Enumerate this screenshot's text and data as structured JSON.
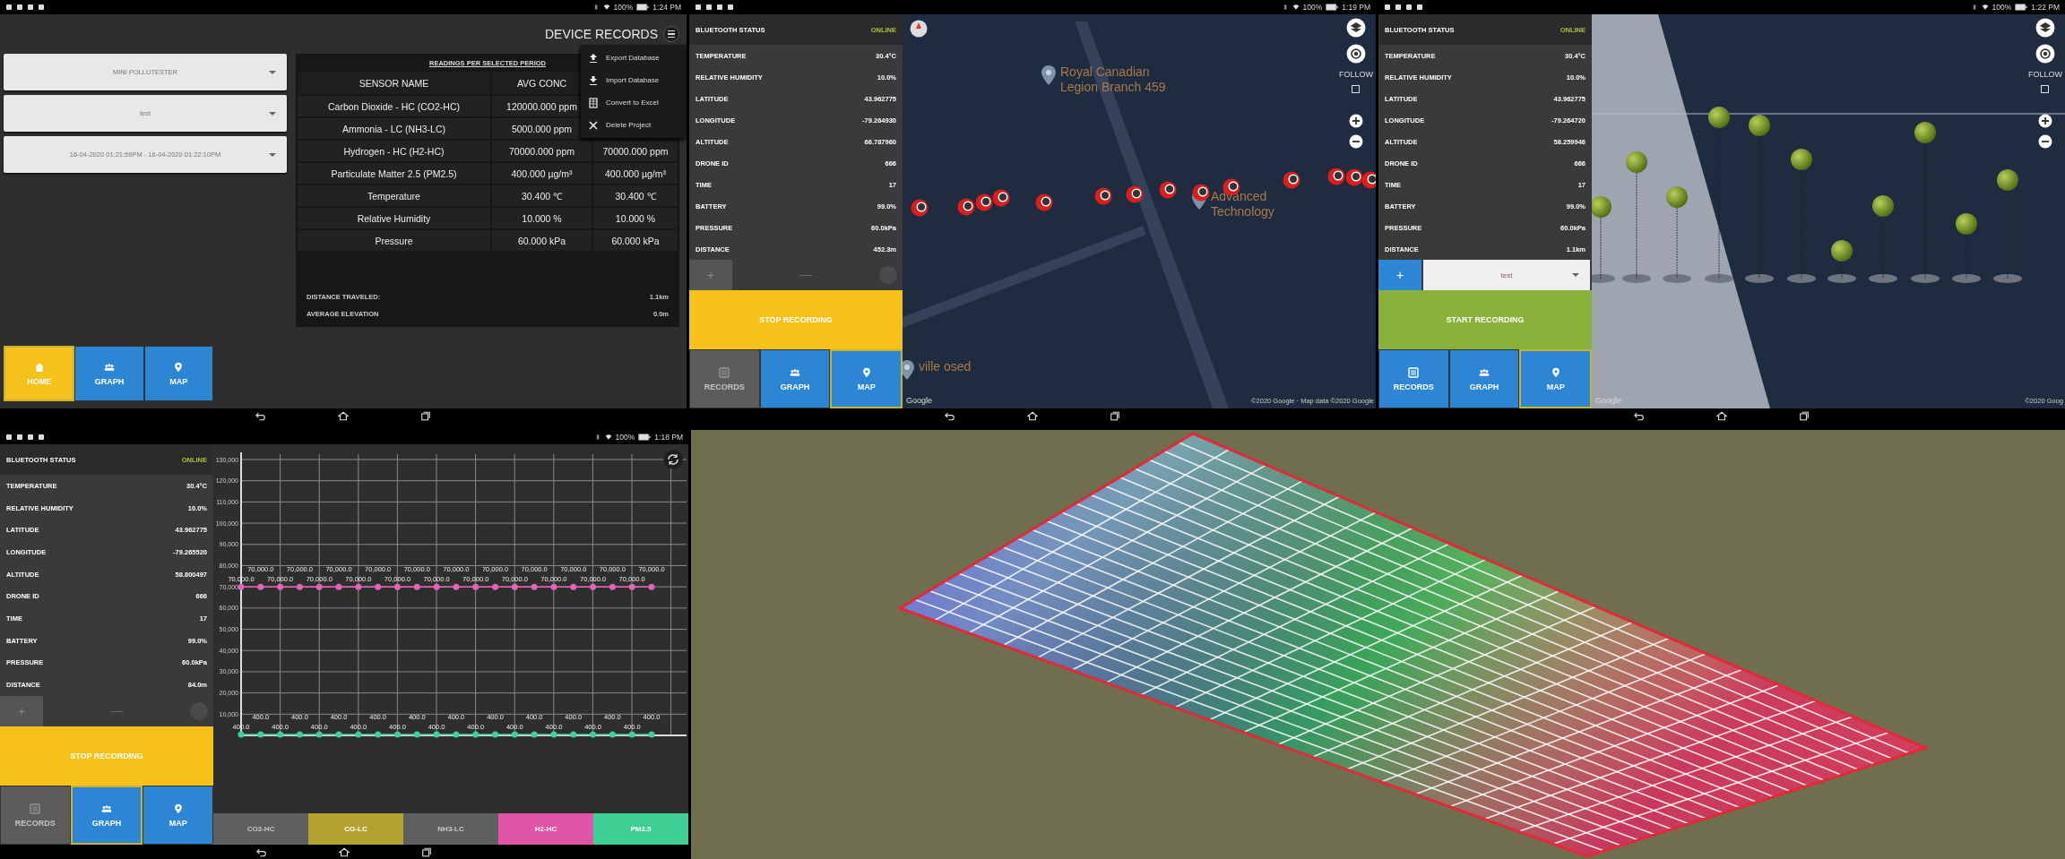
{
  "records_screen": {
    "status_bar": {
      "battery": "100%",
      "time": "1:24 PM"
    },
    "title": "DEVICE RECORDS",
    "dropdowns": [
      {
        "value": "MINI POLLUTESTER"
      },
      {
        "value": "test"
      },
      {
        "value": "16-04-2020 01:21:59PM - 16-04-2020 01:22:10PM"
      }
    ],
    "table": {
      "title": "READINGS PER SELECTED PERIOD",
      "columns": [
        "SENSOR NAME",
        "AVG CONC"
      ],
      "rows": [
        {
          "cells": [
            "Carbon Dioxide - HC (CO2-HC)",
            "120000.000 ppm"
          ]
        },
        {
          "cells": [
            "Ammonia - LC (NH3-LC)",
            "5000.000 ppm"
          ]
        },
        {
          "cells": [
            "Hydrogen - HC (H2-HC)",
            "70000.000 ppm",
            "70000.000 ppm"
          ]
        },
        {
          "cells": [
            "Particulate Matter 2.5 (PM2.5)",
            "400.000 µg/m³",
            "400.000 µg/m³"
          ]
        },
        {
          "cells": [
            "Temperature",
            "30.400 ℃",
            "30.400 ℃"
          ]
        },
        {
          "cells": [
            "Relative Humidity",
            "10.000 %",
            "10.000 %"
          ]
        },
        {
          "cells": [
            "Pressure",
            "60.000 kPa",
            "60.000 kPa"
          ]
        }
      ]
    },
    "menu": {
      "items": [
        {
          "kind": "export",
          "label": "Export Database"
        },
        {
          "kind": "import",
          "label": "Import Database"
        },
        {
          "kind": "excel",
          "label": "Convert to Excel"
        },
        {
          "kind": "delete",
          "label": "Delete Project"
        }
      ]
    },
    "summary": [
      {
        "label": "DISTANCE TRAVELED:",
        "value": "1.1km"
      },
      {
        "label": "AVERAGE ELEVATION",
        "value": "0.0m"
      }
    ],
    "nav_tabs": [
      {
        "kind": "home",
        "label": "HOME",
        "selected": true,
        "disabled": false,
        "color": "#f5c21c"
      },
      {
        "kind": "graph",
        "label": "GRAPH",
        "selected": false,
        "disabled": false,
        "color": "#2d86d4"
      },
      {
        "kind": "map",
        "label": "MAP",
        "selected": false,
        "disabled": false,
        "color": "#2d86d4"
      }
    ]
  },
  "map_screen": {
    "status_bar": {
      "battery": "100%",
      "time": "1:19 PM"
    },
    "sensor_panel": {
      "bluetooth": {
        "label": "BLUETOOTH STATUS",
        "value": "ONLINE"
      },
      "readings": [
        {
          "label": "TEMPERATURE",
          "value": "30.4°C"
        },
        {
          "label": "RELATIVE HUMIDITY",
          "value": "10.0%"
        },
        {
          "label": "LATITUDE",
          "value": "43.962775"
        },
        {
          "label": "LONGITUDE",
          "value": "-79.264930"
        },
        {
          "label": "ALTITUDE",
          "value": "66.787960"
        },
        {
          "label": "DRONE ID",
          "value": "666"
        },
        {
          "label": "TIME",
          "value": "17"
        },
        {
          "label": "BATTERY",
          "value": "99.0%"
        },
        {
          "label": "PRESSURE",
          "value": "60.0kPa"
        },
        {
          "label": "DISTANCE",
          "value": "452.3m"
        }
      ]
    },
    "add_button": {
      "label": "+",
      "disabled": true
    },
    "project_picker": {
      "disabled": true
    },
    "record_button": {
      "label": "STOP RECORDING",
      "recording": true
    },
    "nav_tabs": [
      {
        "kind": "records",
        "label": "RECORDS",
        "selected": false,
        "disabled": true,
        "color": "#5c5c5c"
      },
      {
        "kind": "graph",
        "label": "GRAPH",
        "selected": false,
        "disabled": false,
        "color": "#2d86d4"
      },
      {
        "kind": "map",
        "label": "MAP",
        "selected": true,
        "disabled": false,
        "color": "#2d86d4"
      }
    ],
    "places": [
      {
        "name": "Royal Canadian Legion Branch 459"
      },
      {
        "name": "Advanced Technology"
      },
      {
        "name": "ville osed"
      }
    ],
    "follow": {
      "label": "FOLLOW",
      "checked": false
    },
    "attribution": {
      "logo": "Google",
      "notice": "©2020 Google · Map data ©2020 Google"
    }
  },
  "map_3d_screen": {
    "status_bar": {
      "battery": "100%",
      "time": "1:22 PM"
    },
    "sensor_panel": {
      "bluetooth": {
        "label": "BLUETOOTH STATUS",
        "value": "ONLINE"
      },
      "readings": [
        {
          "label": "TEMPERATURE",
          "value": "30.4°C"
        },
        {
          "label": "RELATIVE HUMIDITY",
          "value": "10.0%"
        },
        {
          "label": "LATITUDE",
          "value": "43.962775"
        },
        {
          "label": "LONGITUDE",
          "value": "-79.264720"
        },
        {
          "label": "ALTITUDE",
          "value": "58.259946"
        },
        {
          "label": "DRONE ID",
          "value": "666"
        },
        {
          "label": "TIME",
          "value": "17"
        },
        {
          "label": "BATTERY",
          "value": "99.0%"
        },
        {
          "label": "PRESSURE",
          "value": "60.0kPa"
        },
        {
          "label": "DISTANCE",
          "value": "1.1km"
        }
      ]
    },
    "add_button": {
      "label": "+",
      "disabled": false
    },
    "project_picker": {
      "disabled": false,
      "value": "test"
    },
    "record_button": {
      "label": "START RECORDING",
      "recording": false
    },
    "nav_tabs": [
      {
        "kind": "records",
        "label": "RECORDS",
        "selected": false,
        "disabled": false,
        "color": "#2d86d4"
      },
      {
        "kind": "graph",
        "label": "GRAPH",
        "selected": false,
        "disabled": false,
        "color": "#2d86d4"
      },
      {
        "kind": "map",
        "label": "MAP",
        "selected": true,
        "disabled": false,
        "color": "#2d86d4"
      }
    ],
    "follow": {
      "label": "FOLLOW",
      "checked": false
    },
    "attribution": {
      "logo": "Google",
      "notice": "©2020 Goog"
    }
  },
  "graph_screen": {
    "status_bar": {
      "battery": "100%",
      "time": "1:18 PM"
    },
    "sensor_panel": {
      "bluetooth": {
        "label": "BLUETOOTH STATUS",
        "value": "ONLINE"
      },
      "readings": [
        {
          "label": "TEMPERATURE",
          "value": "30.4°C"
        },
        {
          "label": "RELATIVE HUMIDITY",
          "value": "10.0%"
        },
        {
          "label": "LATITUDE",
          "value": "43.962775"
        },
        {
          "label": "LONGITUDE",
          "value": "-79.265520"
        },
        {
          "label": "ALTITUDE",
          "value": "58.800497"
        },
        {
          "label": "DRONE ID",
          "value": "666"
        },
        {
          "label": "TIME",
          "value": "17"
        },
        {
          "label": "BATTERY",
          "value": "99.0%"
        },
        {
          "label": "PRESSURE",
          "value": "60.0kPa"
        },
        {
          "label": "DISTANCE",
          "value": "84.0m"
        }
      ]
    },
    "add_button": {
      "label": "+",
      "disabled": true
    },
    "project_picker": {
      "disabled": true
    },
    "record_button": {
      "label": "STOP RECORDING",
      "recording": true
    },
    "nav_tabs": [
      {
        "kind": "records",
        "label": "RECORDS",
        "selected": false,
        "disabled": true,
        "color": "#5c5c5c"
      },
      {
        "kind": "graph",
        "label": "GRAPH",
        "selected": true,
        "disabled": false,
        "color": "#2d86d4"
      },
      {
        "kind": "map",
        "label": "MAP",
        "selected": false,
        "disabled": false,
        "color": "#2d86d4"
      }
    ],
    "chart_data": {
      "type": "line",
      "ylim": [
        0,
        130000
      ],
      "yticks": [
        {
          "value": 10000,
          "label": "10,000"
        },
        {
          "value": 20000,
          "label": "20,000"
        },
        {
          "value": 30000,
          "label": "30,000"
        },
        {
          "value": 40000,
          "label": "40,000"
        },
        {
          "value": 50000,
          "label": "50,000"
        },
        {
          "value": 60000,
          "label": "60,000"
        },
        {
          "value": 70000,
          "label": "70,000"
        },
        {
          "value": 80000,
          "label": "80,000"
        },
        {
          "value": 90000,
          "label": "90,000"
        },
        {
          "value": 100000,
          "label": "100,000"
        },
        {
          "value": 110000,
          "label": "110,000"
        },
        {
          "value": 120000,
          "label": "120,000"
        },
        {
          "value": 130000,
          "label": "130,000"
        }
      ],
      "grid": true,
      "series": [
        {
          "color": "#e264b8",
          "marker": "circle",
          "values": [
            70000,
            70000,
            70000,
            70000,
            70000,
            70000,
            70000,
            70000,
            70000,
            70000,
            70000,
            70000,
            70000,
            70000,
            70000,
            70000,
            70000,
            70000,
            70000,
            70000,
            70000,
            70000
          ],
          "value_labels": [
            "70,000.0",
            "70,000.0",
            "70,000.0",
            "70,000.0",
            "70,000.0",
            "70,000.0",
            "70,000.0",
            "70,000.0",
            "70,000.0",
            "70,000.0",
            "70,000.0",
            "70,000.0",
            "70,000.0",
            "70,000.0",
            "70,000.0",
            "70,000.0",
            "70,000.0",
            "70,000.0",
            "70,000.0",
            "70,000.0",
            "70,000.0",
            "70,000.0"
          ]
        },
        {
          "color": "#3fcf98",
          "marker": "circle",
          "values": [
            400,
            400,
            400,
            400,
            400,
            400,
            400,
            400,
            400,
            400,
            400,
            400,
            400,
            400,
            400,
            400,
            400,
            400,
            400,
            400,
            400,
            400
          ],
          "value_labels": [
            "400.0",
            "400.0",
            "400.0",
            "400.0",
            "400.0",
            "400.0",
            "400.0",
            "400.0",
            "400.0",
            "400.0",
            "400.0",
            "400.0",
            "400.0",
            "400.0",
            "400.0",
            "400.0",
            "400.0",
            "400.0",
            "400.0",
            "400.0",
            "400.0",
            "400.0"
          ]
        }
      ]
    },
    "sensor_tabs": [
      {
        "label": "CO2-HC",
        "selected": false
      },
      {
        "label": "CO-LC",
        "selected": true,
        "color": "#b3a232"
      },
      {
        "label": "NH3-LC",
        "selected": false
      },
      {
        "label": "H2-HC",
        "selected": true,
        "color": "#e055a8"
      },
      {
        "label": "PM2.5",
        "selected": true,
        "color": "#3ecf95"
      }
    ]
  }
}
